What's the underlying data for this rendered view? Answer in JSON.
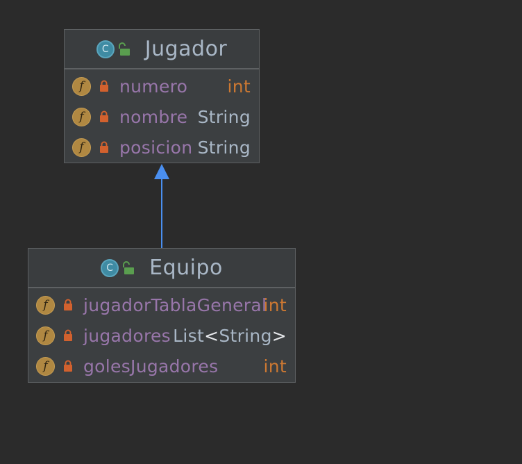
{
  "diagram": {
    "colors": {
      "background": "#2b2b2b",
      "class_fill": "#3c3f41",
      "class_border": "#5e6163",
      "class_name": "#a9b7c6",
      "field_name": "#9876aa",
      "primitive_type": "#cc7832",
      "reference_type": "#a9b7c6",
      "arrow": "#4a8ff0"
    },
    "classes": [
      {
        "name": "Jugador",
        "icon": "class-icon",
        "icon_letter": "C",
        "visibility_icon": "unlock-icon",
        "fields": [
          {
            "icon_letter": "f",
            "name": "numero",
            "type": "int"
          },
          {
            "icon_letter": "f",
            "name": "nombre",
            "type": "String"
          },
          {
            "icon_letter": "f",
            "name": "posicion",
            "type": "String"
          }
        ]
      },
      {
        "name": "Equipo",
        "icon": "class-icon",
        "icon_letter": "C",
        "visibility_icon": "unlock-icon",
        "fields": [
          {
            "icon_letter": "f",
            "name": "jugadorTablaGeneral",
            "type": "int"
          },
          {
            "icon_letter": "f",
            "name": "jugadores",
            "type_prefix": "List",
            "type_open": "<",
            "type_inner": "String",
            "type_close": ">"
          },
          {
            "icon_letter": "f",
            "name": "golesJugadores",
            "type": "int"
          }
        ]
      }
    ],
    "relations": [
      {
        "type": "inheritance",
        "from": "Equipo",
        "to": "Jugador"
      }
    ]
  }
}
